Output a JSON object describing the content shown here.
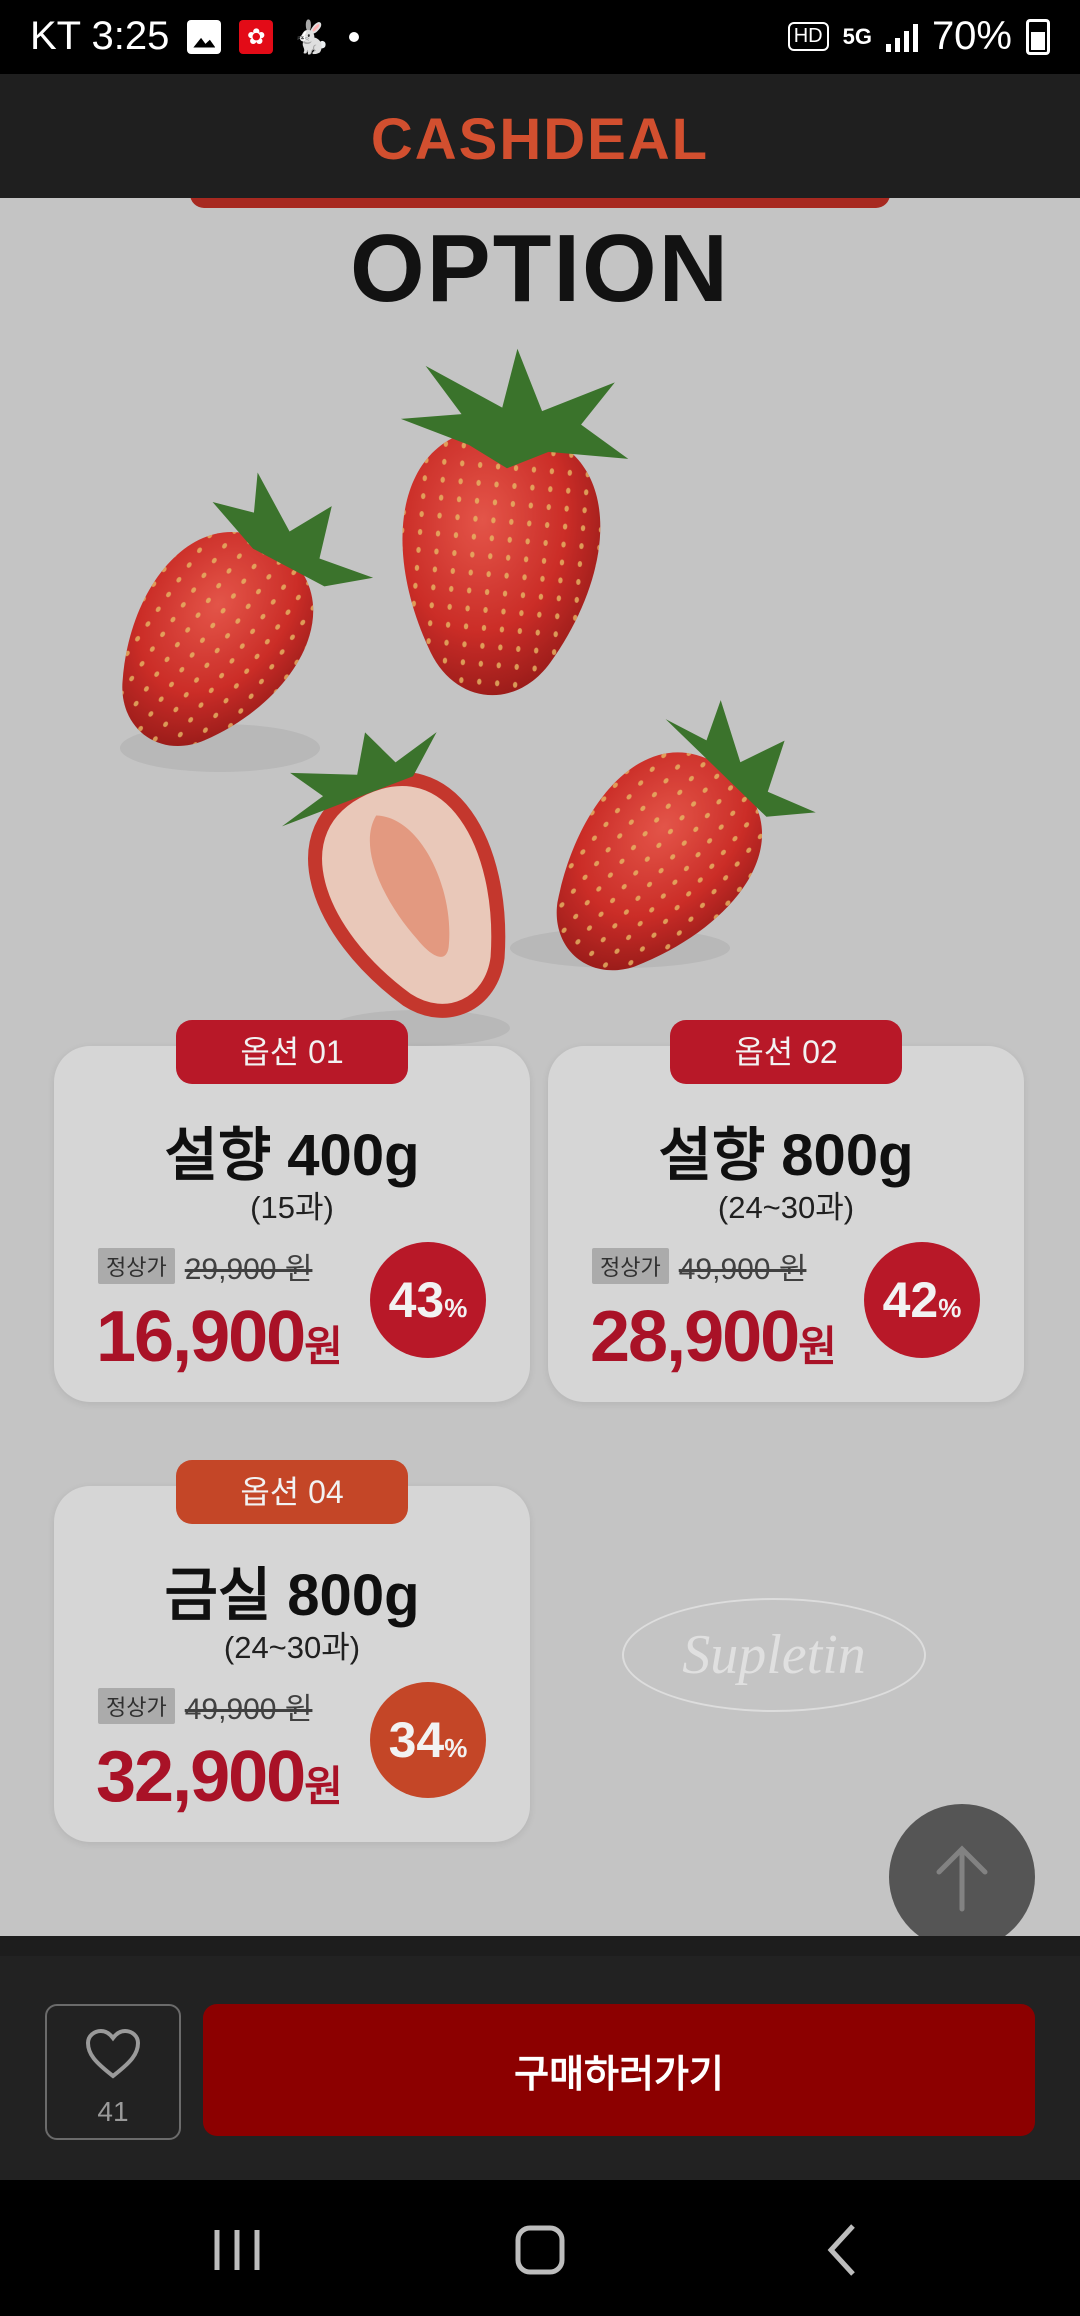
{
  "status_bar": {
    "carrier_time": "KT 3:25",
    "hd": "HD",
    "network": "5G",
    "battery": "70%"
  },
  "header": {
    "logo": "CASHDEAL"
  },
  "banner": {
    "title": "OPTION"
  },
  "options": [
    {
      "tag": "옵션 01",
      "name": "설향 400g",
      "count": "(15과)",
      "regular_label": "정상가",
      "regular_price": "29,900 원",
      "sale_price": "16,900",
      "currency": "원",
      "discount": "43",
      "percent": "%"
    },
    {
      "tag": "옵션 02",
      "name": "설향 800g",
      "count": "(24~30과)",
      "regular_label": "정상가",
      "regular_price": "49,900 원",
      "sale_price": "28,900",
      "currency": "원",
      "discount": "42",
      "percent": "%"
    },
    {
      "tag": "옵션 04",
      "name": "금실 800g",
      "count": "(24~30과)",
      "regular_label": "정상가",
      "regular_price": "49,900 원",
      "sale_price": "32,900",
      "currency": "원",
      "discount": "34",
      "percent": "%"
    }
  ],
  "colors": {
    "option_tag_red": "#c21a2b",
    "option_tag_orange": "#cf4a2a",
    "sale_red": "#b3142a"
  },
  "watermark": "Supletin",
  "bottom": {
    "wishlist_count": "41",
    "buy_label": "구매하러가기"
  }
}
